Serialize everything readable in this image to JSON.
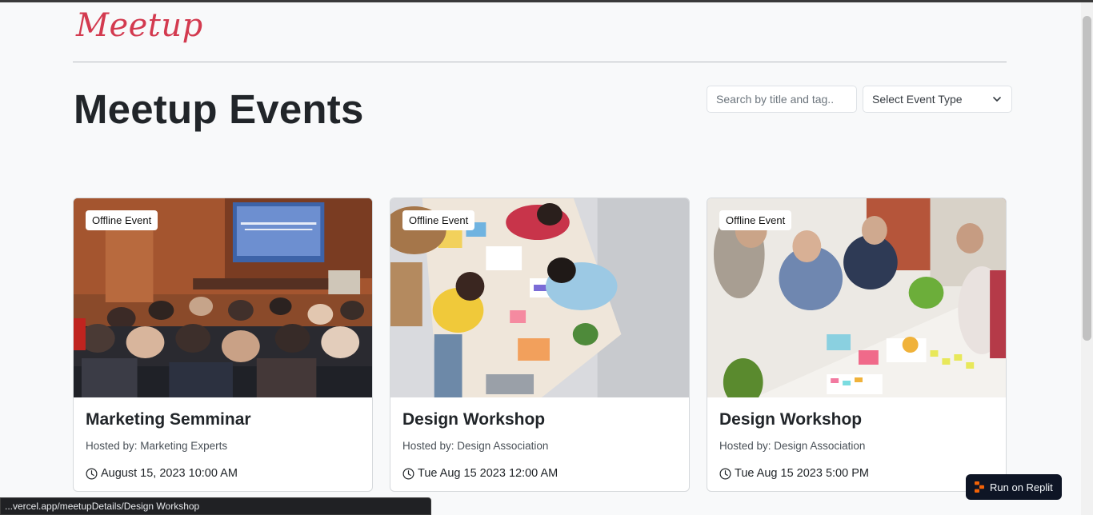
{
  "header": {
    "brand": "Meetup"
  },
  "main": {
    "title": "Meetup Events",
    "search": {
      "placeholder": "Search by title and tag.."
    },
    "event_type_select": {
      "selected": "Select Event Type"
    }
  },
  "events": [
    {
      "badge": "Offline Event",
      "title": "Marketing Semminar",
      "host": "Hosted by: Marketing Experts",
      "date": "August 15, 2023 10:00 AM",
      "image": "conference-audience-photo"
    },
    {
      "badge": "Offline Event",
      "title": "Design Workshop",
      "host": "Hosted by: Design Association",
      "date": "Tue Aug 15 2023 12:00 AM",
      "image": "team-design-table-photo"
    },
    {
      "badge": "Offline Event",
      "title": "Design Workshop",
      "host": "Hosted by: Design Association",
      "date": "Tue Aug 15 2023 5:00 PM",
      "image": "designers-meeting-photo"
    }
  ],
  "status_bar": {
    "url": "...vercel.app/meetupDetails/Design Workshop"
  },
  "replit": {
    "label": "Run on Replit"
  },
  "colors": {
    "brand": "#d33a4f",
    "background": "#f8f9fa",
    "replit_button": "#0e1525"
  }
}
